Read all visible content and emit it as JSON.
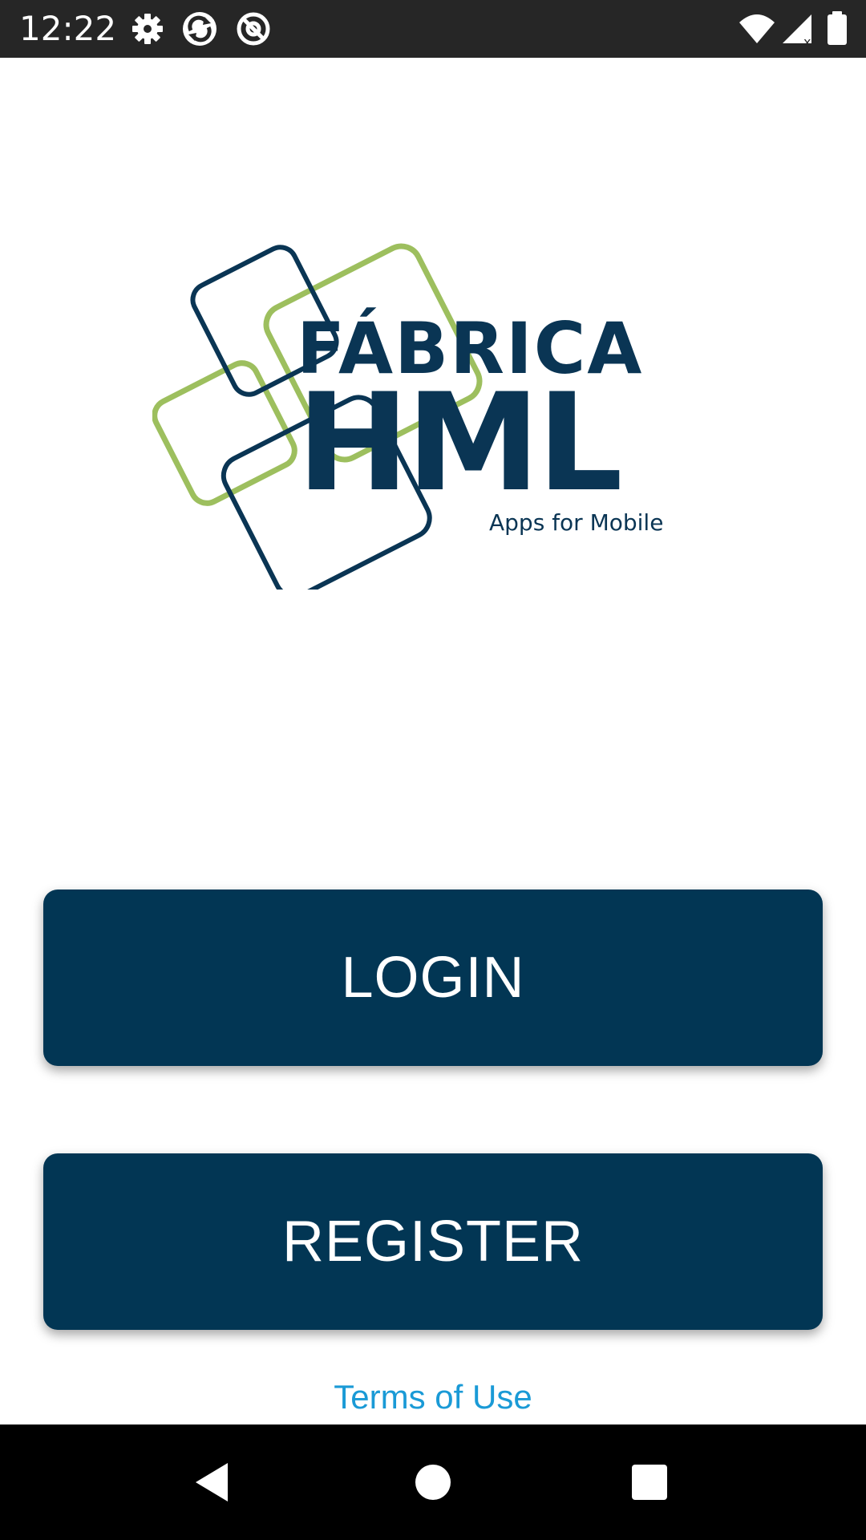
{
  "status_bar": {
    "time": "12:22",
    "left_icons": [
      "gear-icon",
      "sync-icon",
      "at-sign-icon"
    ],
    "right_icons": [
      "wifi-icon",
      "cell-signal-icon",
      "battery-icon"
    ]
  },
  "logo": {
    "word_top": "FÁBRICA",
    "word_main": "HML",
    "tagline": "Apps for Mobile",
    "colors": {
      "navy": "#0a3554",
      "green": "#9dbf5e"
    }
  },
  "buttons": {
    "login_label": "LOGIN",
    "register_label": "REGISTER",
    "color": "#023654"
  },
  "terms": {
    "label": "Terms of Use",
    "color": "#1a9ad6"
  },
  "nav_bar": {
    "icons": [
      "back-icon",
      "home-icon",
      "recents-icon"
    ]
  }
}
